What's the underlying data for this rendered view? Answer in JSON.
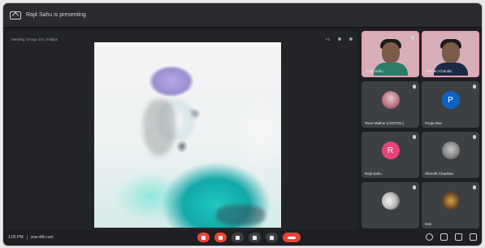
{
  "topbar": {
    "presenting_text": "Rajit Sahu is presenting"
  },
  "stage": {
    "label": "Meeting: Group of 5, 8 Mbps",
    "control_label": "Fit",
    "image_alt": "shared image"
  },
  "participants": [
    {
      "name": "Rajit Sahu",
      "type": "video"
    },
    {
      "name": "Mohan Chanda",
      "type": "video"
    },
    {
      "name": "Tanvi Mathur (HOSTEL)",
      "type": "photo"
    },
    {
      "name": "Pooja Das",
      "type": "initial",
      "initial": "P",
      "color": "#0b64c5"
    },
    {
      "name": "Rajit Sahu",
      "type": "initial",
      "initial": "R",
      "color": "#e6447a"
    },
    {
      "name": "Shresth Chauhan",
      "type": "photo"
    },
    {
      "name": "",
      "type": "photo"
    },
    {
      "name": "Hari",
      "type": "photo"
    }
  ],
  "bottombar": {
    "time": "1:05 PM",
    "meeting_code": "sna-ofbi-rum"
  }
}
